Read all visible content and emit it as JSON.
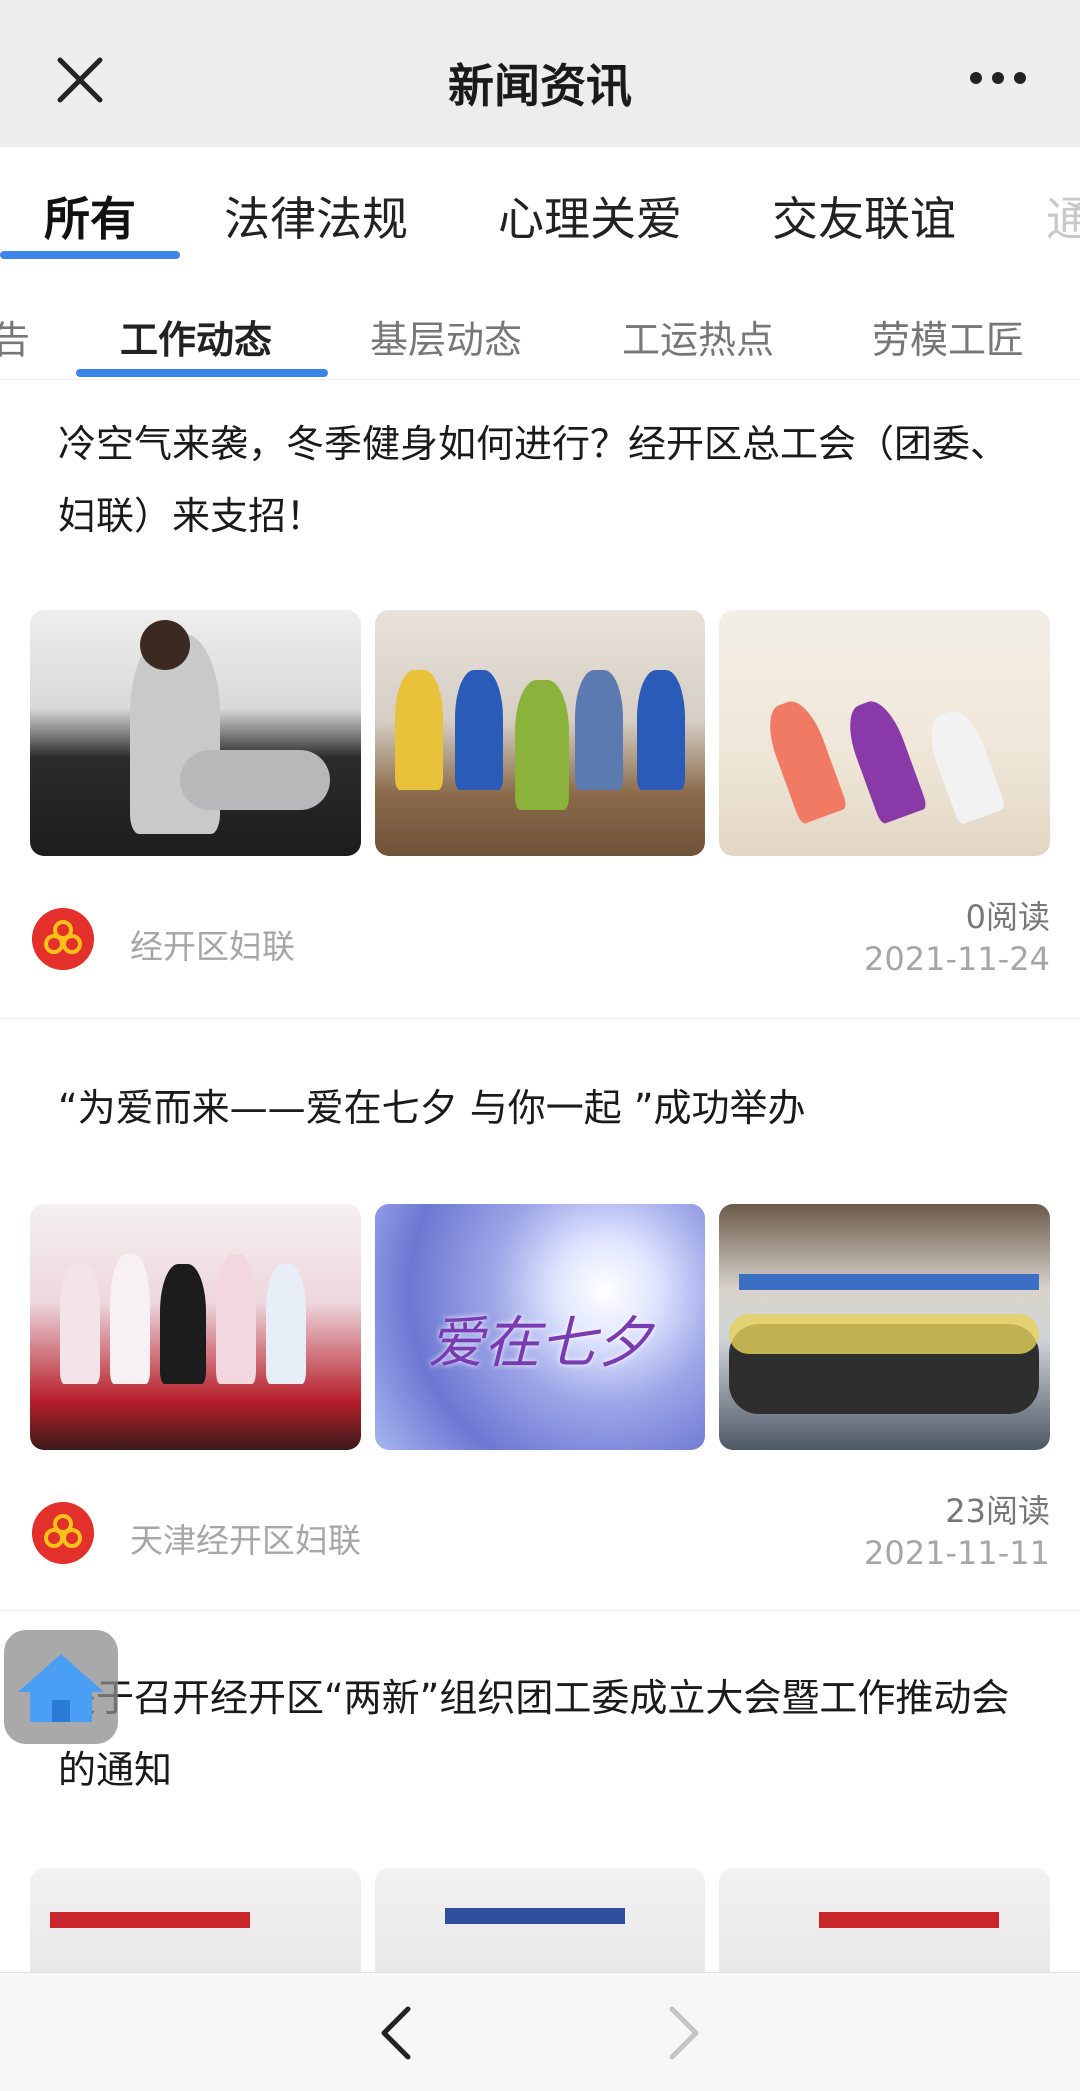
{
  "header": {
    "title": "新闻资讯",
    "close_icon": "close-icon",
    "more_icon": "more-icon"
  },
  "tabs_primary": [
    {
      "label": "所有",
      "active": true
    },
    {
      "label": "法律法规",
      "active": false
    },
    {
      "label": "心理关爱",
      "active": false
    },
    {
      "label": "交友联谊",
      "active": false
    },
    {
      "label": "通",
      "active": false
    }
  ],
  "tabs_secondary": [
    {
      "label": "告",
      "active": false
    },
    {
      "label": "工作动态",
      "active": true
    },
    {
      "label": "基层动态",
      "active": false
    },
    {
      "label": "工运热点",
      "active": false
    },
    {
      "label": "劳模工匠",
      "active": false
    }
  ],
  "articles": [
    {
      "title": "冷空气来袭，冬季健身如何进行？经开区总工会（团委、妇联）来支招！",
      "source": "经开区妇联",
      "reads": "0阅读",
      "date": "2021-11-24"
    },
    {
      "title": "“为爱而来——爱在七夕 与你一起 ”成功举办",
      "source": "天津经开区妇联",
      "reads": "23阅读",
      "date": "2021-11-11",
      "image_text": "爱在七夕"
    },
    {
      "title": "关于召开经开区“两新”组织团工委成立大会暨工作推动会的通知"
    }
  ],
  "colors": {
    "accent": "#3d86e8",
    "logo_red": "#e3302a",
    "logo_yellow": "#f7c21a"
  },
  "floating": {
    "home_icon": "home-icon"
  },
  "bottom_nav": {
    "back_icon": "chevron-left-icon",
    "forward_icon": "chevron-right-icon"
  }
}
